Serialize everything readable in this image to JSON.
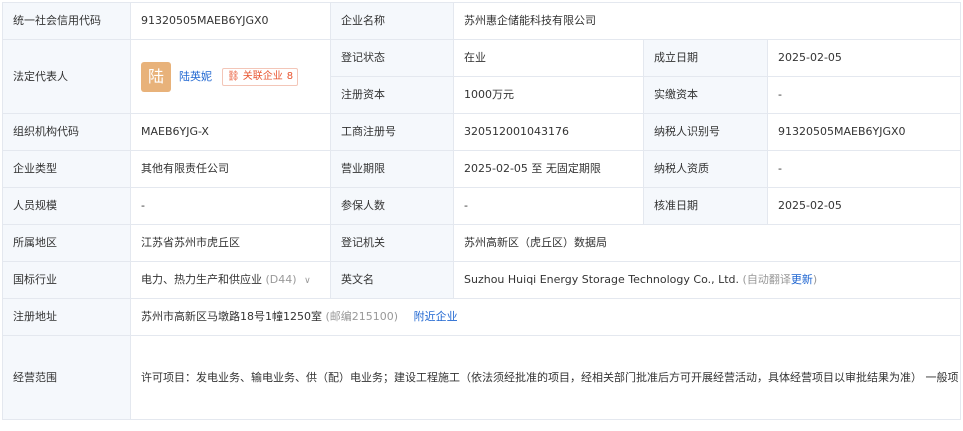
{
  "rows": {
    "credit_code": {
      "label": "统一社会信用代码",
      "value": "91320505MAEB6YJGX0"
    },
    "company_name": {
      "label": "企业名称",
      "value": "苏州惠企储能科技有限公司"
    },
    "legal_rep": {
      "label": "法定代表人",
      "avatar_char": "陆",
      "name": "陆英妮",
      "related_label": "关联企业",
      "related_count": "8"
    },
    "reg_status": {
      "label": "登记状态",
      "value": "在业"
    },
    "est_date": {
      "label": "成立日期",
      "value": "2025-02-05"
    },
    "reg_capital": {
      "label": "注册资本",
      "value": "1000万元"
    },
    "paid_capital": {
      "label": "实缴资本",
      "value": "-"
    },
    "org_code": {
      "label": "组织机构代码",
      "value": "MAEB6YJG-X"
    },
    "biz_reg_no": {
      "label": "工商注册号",
      "value": "320512001043176"
    },
    "taxpayer_id": {
      "label": "纳税人识别号",
      "value": "91320505MAEB6YJGX0"
    },
    "company_type": {
      "label": "企业类型",
      "value": "其他有限责任公司"
    },
    "biz_term": {
      "label": "营业期限",
      "value": "2025-02-05 至 无固定期限"
    },
    "taxpayer_qual": {
      "label": "纳税人资质",
      "value": "-"
    },
    "staff_size": {
      "label": "人员规模",
      "value": "-"
    },
    "insured": {
      "label": "参保人数",
      "value": "-"
    },
    "approval_date": {
      "label": "核准日期",
      "value": "2025-02-05"
    },
    "region": {
      "label": "所属地区",
      "value": "江苏省苏州市虎丘区"
    },
    "reg_authority": {
      "label": "登记机关",
      "value": "苏州高新区（虎丘区）数据局"
    },
    "industry": {
      "label": "国标行业",
      "value": "电力、热力生产和供应业",
      "code": "(D44)"
    },
    "english_name": {
      "label": "英文名",
      "value": "Suzhou Huiqi Energy Storage Technology Co., Ltd.",
      "auto_note": "(自动翻译",
      "update_link": "更新",
      "note_close": ")"
    },
    "address": {
      "label": "注册地址",
      "value": "苏州市高新区马墩路18号1幢1250室",
      "postcode": "(邮编215100)",
      "nearby_link": "附近企业"
    },
    "scope": {
      "label": "经营范围",
      "value": "许可项目：发电业务、输电业务、供（配）电业务；建设工程施工（依法须经批准的项目，经相关部门批准后方可开展经营活动，具体经营项目以审批结果为准）  一般项目：储能技术服务；太阳能发电技术服务；技术服务、技术开发、技术咨询、技术交流、技术转让、技术推广；电池销售；电池零配件销售；光伏发电设备租赁；光伏设备及元器件销售；合同能源管理；网络技术服务；通用设备修理；网络设备销售；软件开发；云计算设备销售；软件销售；5G通信技术服务；工业互联网数据服务；数据处理和存储支持服务（除依法须经批准的项目外，凭营业执照依法自主开展经营活动）"
    }
  }
}
